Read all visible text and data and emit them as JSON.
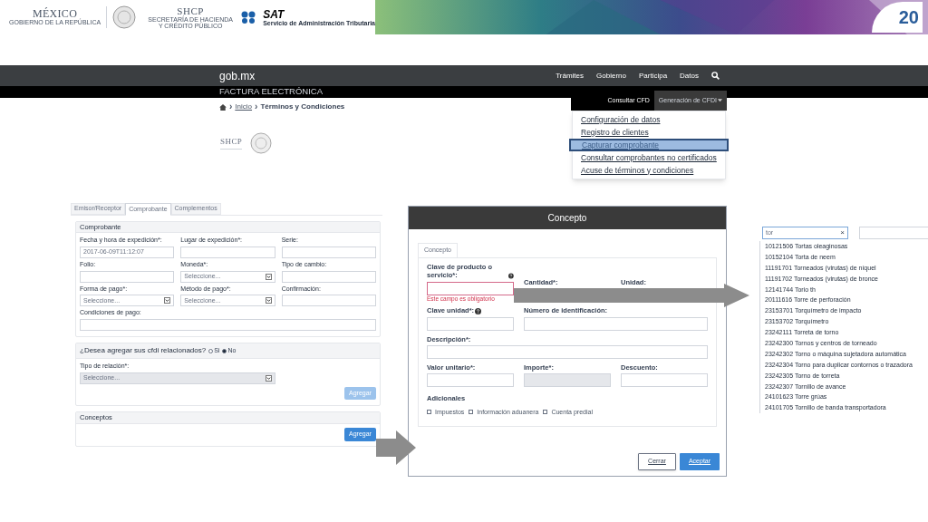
{
  "header": {
    "mexico": {
      "title": "MÉXICO",
      "subtitle": "GOBIERNO DE LA REPÚBLICA"
    },
    "shcp": {
      "title": "SHCP",
      "subtitle": "SECRETARÍA DE HACIENDA Y CRÉDITO PÚBLICO"
    },
    "sat": {
      "title": "SAT",
      "subtitle": "Servicio de Administración Tributaria"
    },
    "anniversary": "20"
  },
  "navbar": {
    "brand": "gob.mx",
    "links": [
      "Trámites",
      "Gobierno",
      "Participa",
      "Datos"
    ]
  },
  "subbar": {
    "title": "FACTURA ELECTRÓNICA",
    "tabs": [
      {
        "label": "Consultar CFD",
        "selected": false
      },
      {
        "label": "Generación de CFDI",
        "selected": true
      }
    ]
  },
  "breadcrumb": {
    "separator": "›",
    "items": [
      "Inicio",
      "Términos y Condiciones"
    ]
  },
  "small_logo": "SHCP",
  "menu": [
    {
      "label": "Configuración de datos",
      "selected": false
    },
    {
      "label": "Registro de clientes",
      "selected": false
    },
    {
      "label": "Capturar comprobante",
      "selected": true
    },
    {
      "label": "Consultar comprobantes no certificados",
      "selected": false
    },
    {
      "label": "Acuse de términos y condiciones",
      "selected": false
    }
  ],
  "form": {
    "tabs": [
      {
        "label": "Emisor/Receptor",
        "selected": false
      },
      {
        "label": "Comprobante",
        "selected": true
      },
      {
        "label": "Complementos",
        "selected": false
      }
    ],
    "title": "Comprobante",
    "rows": [
      [
        {
          "label": "Fecha y hora de expedición*:",
          "kind": "text",
          "value": "2017-06-09T11:12:07"
        },
        {
          "label": "Lugar de expedición*:",
          "kind": "text"
        },
        {
          "label": "Serie:",
          "kind": "text"
        }
      ],
      [
        {
          "label": "Folio:",
          "kind": "text"
        },
        {
          "label": "Moneda*:",
          "kind": "select",
          "value": "Seleccione..."
        },
        {
          "label": "Tipo de cambio:",
          "kind": "text"
        }
      ],
      [
        {
          "label": "Forma de pago*:",
          "kind": "select",
          "value": "Seleccione..."
        },
        {
          "label": "Método de pago*:",
          "kind": "select",
          "value": "Seleccione..."
        },
        {
          "label": "Confirmación:",
          "kind": "text"
        }
      ],
      [
        {
          "label": "Condiciones de pago:",
          "kind": "text"
        }
      ]
    ],
    "related": {
      "question": "¿Desea agregar sus cfdi relacionados?",
      "options": [
        {
          "label": "Si",
          "selected": false
        },
        {
          "label": "No",
          "selected": true
        }
      ],
      "field": {
        "label": "Tipo de relación*:",
        "kind": "select",
        "value": "Seleccione...",
        "disabled": true
      },
      "button": {
        "label": "Agregar",
        "disabled": true
      }
    },
    "concepts": {
      "title": "Conceptos",
      "button": {
        "label": "Agregar",
        "disabled": false
      }
    }
  },
  "modal": {
    "title": "Concepto",
    "tab": "Concepto",
    "rows": [
      [
        {
          "label": "Clave de producto o servicio*:",
          "kind": "text",
          "help": true,
          "error": "Este campo es obligatorio"
        },
        {
          "label": "Cantidad*:",
          "kind": "label"
        },
        {
          "label": "Unidad:",
          "kind": "label"
        }
      ],
      [
        {
          "label": "Clave unidad*:",
          "kind": "text",
          "help": true
        },
        {
          "label": "Número de identificación:",
          "kind": "text"
        }
      ],
      [
        {
          "label": "Descripción*:",
          "kind": "text"
        }
      ],
      [
        {
          "label": "Valor unitario*:",
          "kind": "text"
        },
        {
          "label": "Importe*:",
          "kind": "text",
          "disabled": true
        },
        {
          "label": "Descuento:",
          "kind": "text"
        }
      ]
    ],
    "extras_title": "Adicionales",
    "extras": [
      {
        "label": "Impuestos",
        "checked": false
      },
      {
        "label": "Información aduanera",
        "checked": false
      },
      {
        "label": "Cuenta predial",
        "checked": false
      }
    ],
    "buttons": [
      {
        "label": "Cerrar",
        "kind": "secondary"
      },
      {
        "label": "Aceptar",
        "kind": "primary"
      }
    ]
  },
  "search": {
    "value": "tor",
    "clear": "×",
    "results": [
      "10121506 Tortas oleaginosas",
      "10152104 Torta de neem",
      "11191701 Torneados (virutas) de níquel",
      "11191702 Torneados (virutas) de bronce",
      "12141744 Torio th",
      "20111616 Torre de perforación",
      "23153701 Torquímetro de impacto",
      "23153702 Torquímetro",
      "23242111 Torreta de torno",
      "23242300 Tornos y centros de torneado",
      "23242302 Torno o máquina sujetadora automática",
      "23242304 Torno para duplicar contornos o trazadora",
      "23242305 Torno de torreta",
      "23242307 Tornillo de avance",
      "24101623 Torre grúas",
      "24101705 Tornillo de banda transportadora"
    ]
  }
}
